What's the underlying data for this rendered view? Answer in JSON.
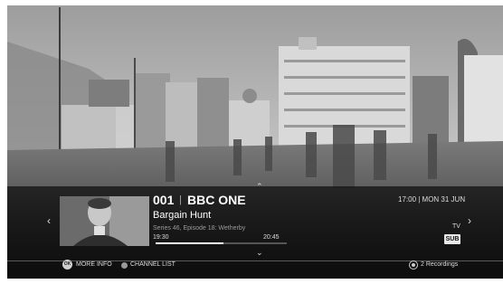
{
  "channel": {
    "number": "001",
    "name": "BBC ONE"
  },
  "datetime": "17:00 | MON 31 JUN",
  "programme": {
    "title": "Bargain Hunt",
    "episode": "Series 46, Episode 18: Wetherby",
    "start_time": "19:30",
    "end_time": "20:45",
    "progress": 0.52
  },
  "badges": {
    "tv": "TV",
    "sub": "SUB"
  },
  "footer": {
    "more_info_button": "OK",
    "more_info_label": "MORE INFO",
    "channel_list_label": "CHANNEL LIST",
    "recordings_label": "2 Recordings"
  },
  "icons": {
    "left": "chevron-left-icon",
    "right": "chevron-right-icon",
    "up": "chevron-up-icon",
    "down": "chevron-down-icon"
  },
  "colors": {
    "overlay": "#141414",
    "text": "#ffffff",
    "muted": "#9a9a9a"
  }
}
